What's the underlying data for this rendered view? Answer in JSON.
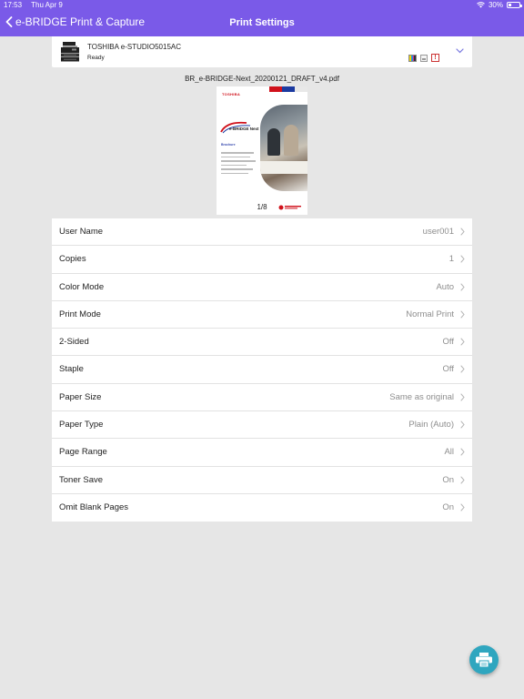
{
  "status_bar": {
    "time": "17:53",
    "date": "Thu Apr 9",
    "battery": "30%",
    "battery_level": 0.3
  },
  "nav": {
    "back_label": "e-BRIDGE Print & Capture",
    "title": "Print Settings"
  },
  "printer": {
    "name": "TOSHIBA e-STUDIO5015AC",
    "status": "Ready",
    "toner_colors": [
      "#f5d800",
      "#2a8fe0",
      "#e0208a",
      "#333333"
    ],
    "alert_symbol": "!"
  },
  "document": {
    "file_name": "BR_e-BRIDGE-Next_20200121_DRAFT_v4.pdf",
    "page_indicator": "1/8",
    "preview": {
      "logo": "TOSHIBA",
      "brand": "e-BRIDGE Next",
      "subtitle": "Brochure"
    }
  },
  "settings": [
    {
      "label": "User Name",
      "value": "user001"
    },
    {
      "label": "Copies",
      "value": "1"
    },
    {
      "label": "Color Mode",
      "value": "Auto"
    },
    {
      "label": "Print Mode",
      "value": "Normal Print"
    },
    {
      "label": "2-Sided",
      "value": "Off"
    },
    {
      "label": "Staple",
      "value": "Off"
    },
    {
      "label": "Paper Size",
      "value": "Same as original"
    },
    {
      "label": "Paper Type",
      "value": "Plain (Auto)"
    },
    {
      "label": "Page Range",
      "value": "All"
    },
    {
      "label": "Toner Save",
      "value": "On"
    },
    {
      "label": "Omit Blank Pages",
      "value": "On"
    }
  ],
  "colors": {
    "header": "#7a5ae8",
    "fab": "#2fa6bf",
    "background": "#e6e6e6"
  },
  "icons": {
    "back": "chevron-left-icon",
    "dropdown": "chevron-down-icon",
    "row": "chevron-right-icon",
    "print": "printer-icon"
  }
}
